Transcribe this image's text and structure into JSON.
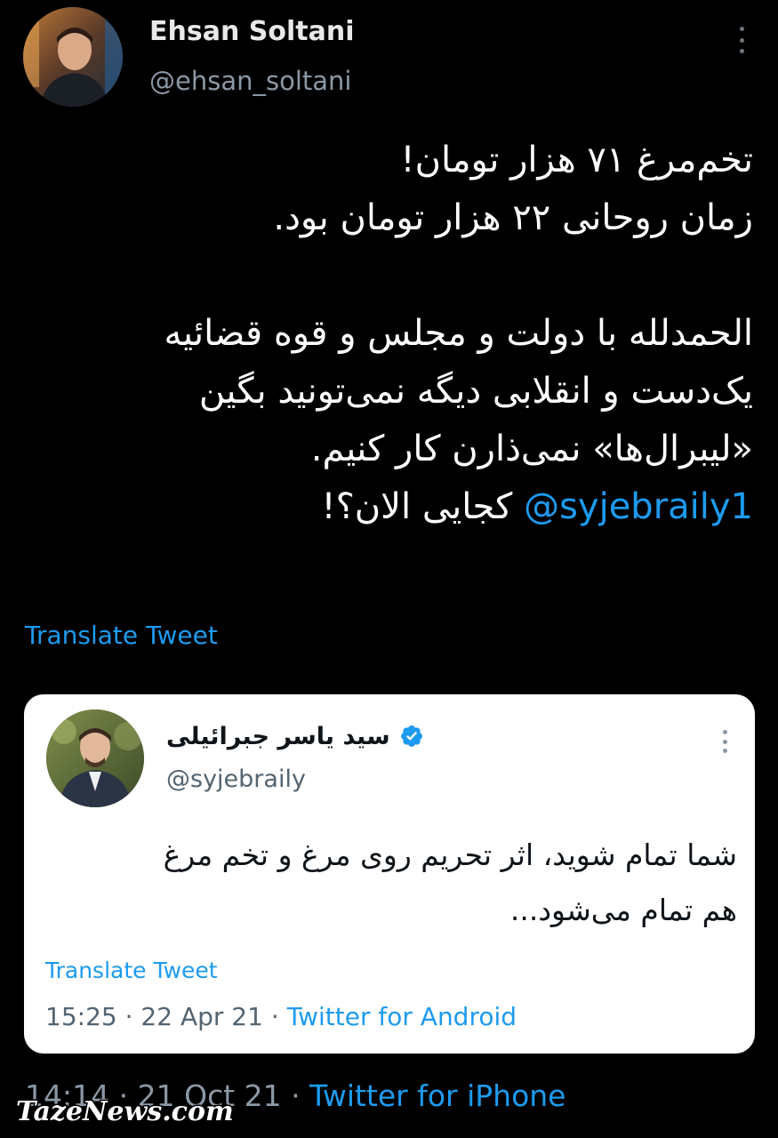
{
  "colors": {
    "background": "#000000",
    "link": "#1d9bf0",
    "secondary_text": "#8b98a5",
    "card_background": "#ffffff"
  },
  "author": {
    "name": "Ehsan Soltani",
    "handle": "@ehsan_soltani",
    "avatar_icon": "avatar-photo"
  },
  "tweet": {
    "lines": [
      "تخم‌مرغ ۷۱ هزار تومان!",
      "زمان روحانی ۲۲ هزار تومان بود.",
      "",
      "الحمدلله با دولت و مجلس و قوه قضائیه",
      "یک‌دست و انقلابی دیگه نمی‌تونید بگین",
      "«لیبرال‌ها» نمی‌ذارن کار کنیم."
    ],
    "last_line_mention": "@syjebraily1",
    "last_line_text": " کجایی الان؟!",
    "translate_label": "Translate Tweet",
    "time": "14:14",
    "date": "21 Oct 21",
    "separator": "·",
    "source": "Twitter for iPhone"
  },
  "quoted": {
    "name": "سید یاسر جبرائیلی",
    "handle": "@syjebraily",
    "verified_icon": "verified-badge-icon",
    "lines": [
      "شما تمام شوید، اثر تحریم روی مرغ و تخم مرغ",
      "هم تمام می‌شود..."
    ],
    "translate_label": "Translate Tweet",
    "time": "15:25",
    "date": "22 Apr 21",
    "separator": "·",
    "source": "Twitter for Android"
  },
  "watermark": {
    "text": "TazeNews.com"
  }
}
